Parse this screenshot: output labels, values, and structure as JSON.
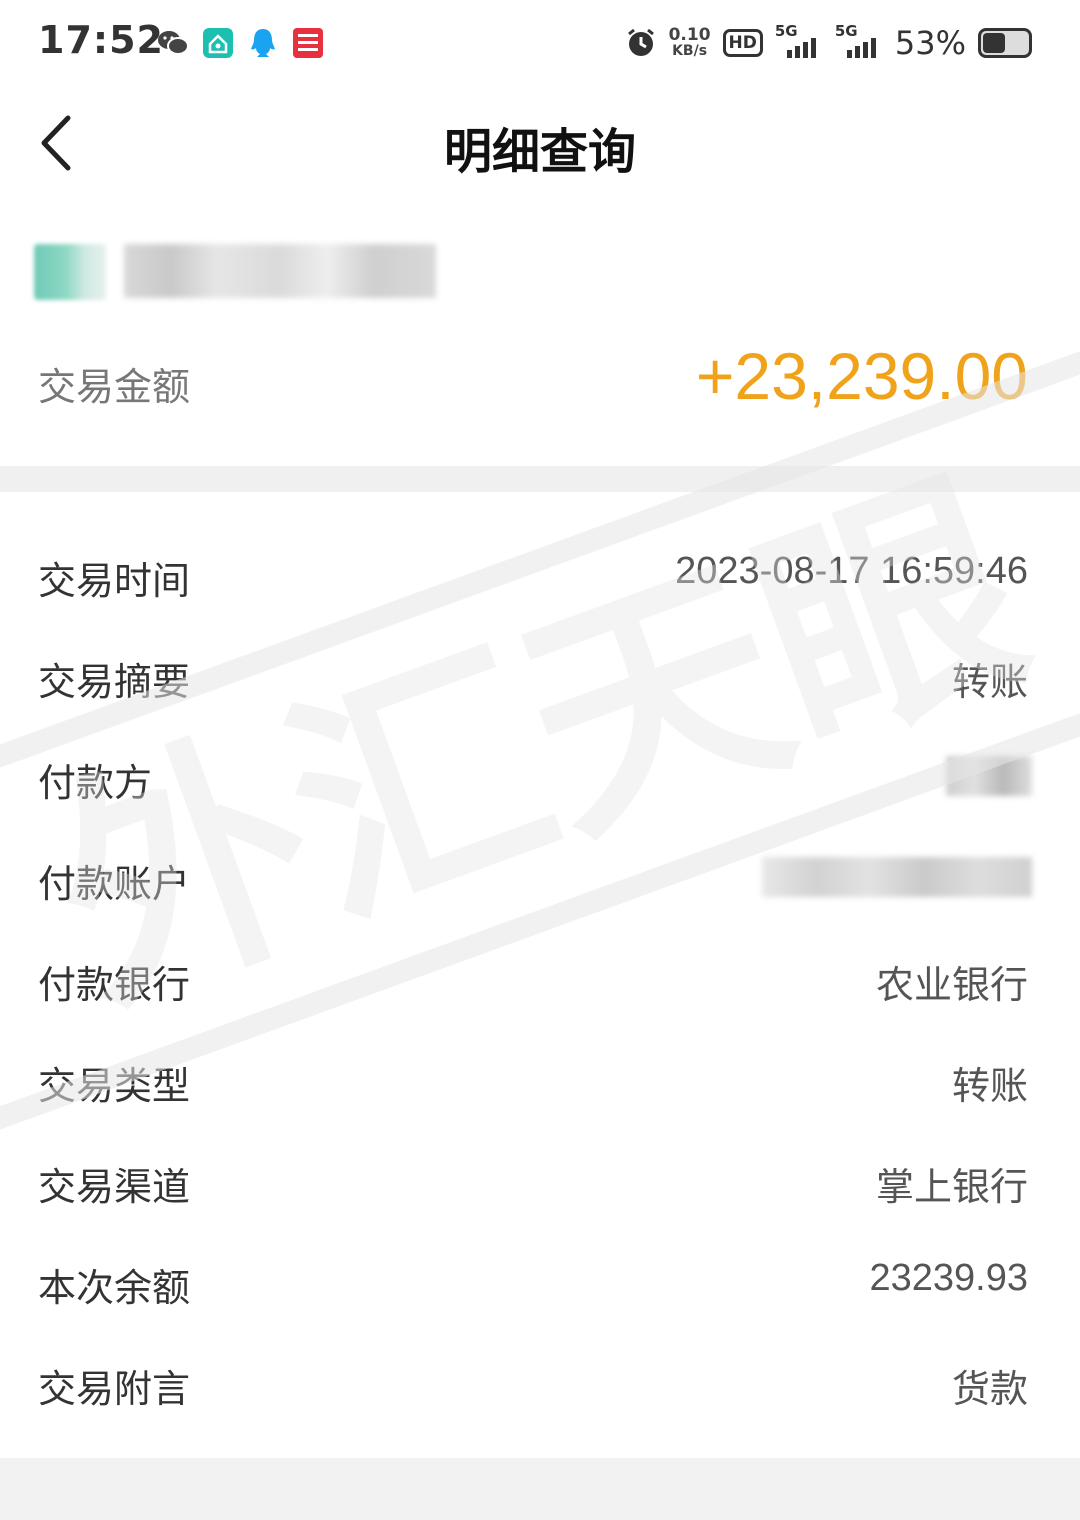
{
  "status_bar": {
    "time": "17:52",
    "net_speed_value": "0.10",
    "net_speed_unit": "KB/s",
    "hd_label": "HD",
    "signal1_label": "5G",
    "signal2_label": "5G",
    "battery_percent": "53%",
    "battery_level": 0.53
  },
  "header": {
    "title": "明细查询"
  },
  "amount": {
    "label": "交易金额",
    "value": "+23,239.00",
    "color": "#f0a31a"
  },
  "details": [
    {
      "label": "交易时间",
      "value": "2023-08-17 16:59:46"
    },
    {
      "label": "交易摘要",
      "value": "转账"
    },
    {
      "label": "付款方",
      "value": ""
    },
    {
      "label": "付款账户",
      "value": ""
    },
    {
      "label": "付款银行",
      "value": "农业银行"
    },
    {
      "label": "交易类型",
      "value": "转账"
    },
    {
      "label": "交易渠道",
      "value": "掌上银行"
    },
    {
      "label": "本次余额",
      "value": "23239.93"
    },
    {
      "label": "交易附言",
      "value": "货款"
    }
  ],
  "watermark": {
    "text": "外汇天眼"
  },
  "icons": {
    "back": "chevron-left-icon",
    "status": [
      "wechat-icon",
      "home-app-icon",
      "qq-icon",
      "red-app-icon",
      "alarm-icon"
    ]
  }
}
